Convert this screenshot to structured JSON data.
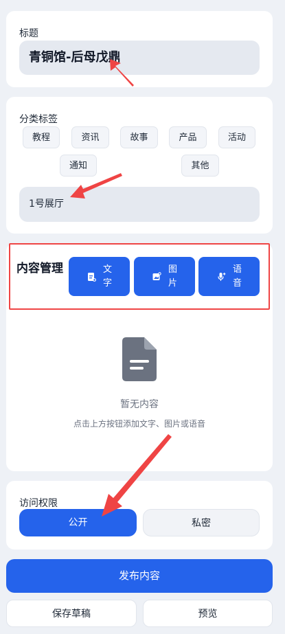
{
  "title_section": {
    "label": "标题",
    "value": "青铜馆-后母戊鼎"
  },
  "category_section": {
    "label": "分类标签",
    "tags": [
      "教程",
      "资讯",
      "故事",
      "产品",
      "活动",
      "通知",
      "其他"
    ],
    "location_value": "1号展厅"
  },
  "content_section": {
    "title": "内容管理",
    "buttons": [
      {
        "label": "文字",
        "icon": "document-plus-icon"
      },
      {
        "label": "图片",
        "icon": "image-plus-icon"
      },
      {
        "label": "语音",
        "icon": "microphone-plus-icon"
      }
    ],
    "empty_icon": "document-icon",
    "empty_title": "暂无内容",
    "empty_hint": "点击上方按钮添加文字、图片或语音"
  },
  "access_section": {
    "label": "访问权限",
    "options": [
      "公开",
      "私密"
    ],
    "selected": "公开"
  },
  "actions": {
    "publish": "发布内容",
    "save_draft": "保存草稿",
    "preview": "预览"
  },
  "colors": {
    "accent": "#2563eb",
    "highlight_border": "#ef4444",
    "annotation_arrow": "#ef4444"
  }
}
